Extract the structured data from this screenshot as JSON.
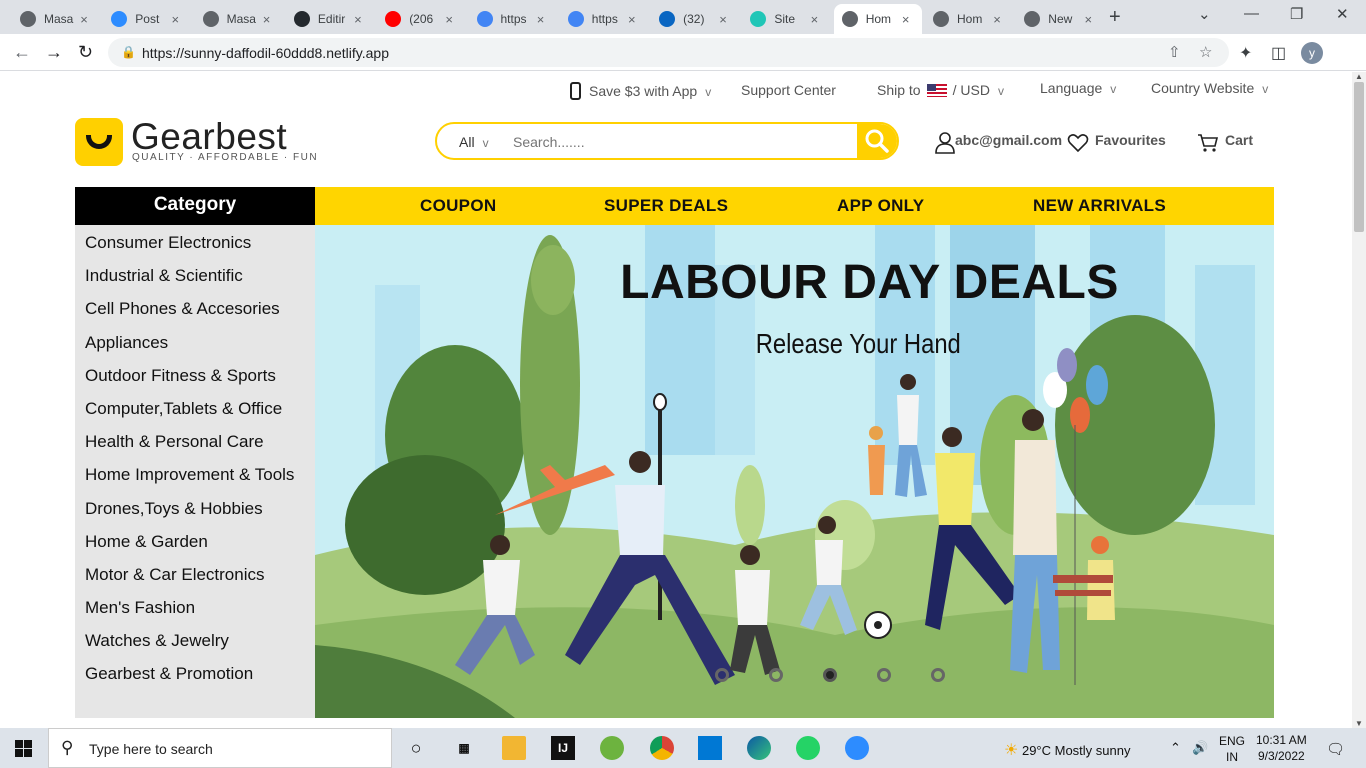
{
  "browser": {
    "tabs": [
      {
        "title": "Masa",
        "icon": "globe-icon",
        "color": "#5f6368"
      },
      {
        "title": "Post",
        "icon": "zoom-icon",
        "color": "#2d8cff"
      },
      {
        "title": "Masa",
        "icon": "globe-icon",
        "color": "#5f6368"
      },
      {
        "title": "Editir",
        "icon": "github-icon",
        "color": "#24292e"
      },
      {
        "title": "(206",
        "icon": "youtube-icon",
        "color": "#ff0000"
      },
      {
        "title": "https",
        "icon": "google-icon",
        "color": "#4285f4"
      },
      {
        "title": "https",
        "icon": "google-icon",
        "color": "#4285f4"
      },
      {
        "title": "(32)",
        "icon": "linkedin-icon",
        "color": "#0a66c2"
      },
      {
        "title": "Site",
        "icon": "netlify-icon",
        "color": "#20c6b7"
      },
      {
        "title": "Hom",
        "icon": "globe-icon",
        "color": "#5f6368",
        "active": true
      },
      {
        "title": "Hom",
        "icon": "globe-icon",
        "color": "#5f6368"
      },
      {
        "title": "New",
        "icon": "chrome-icon",
        "color": "#5f6368"
      }
    ],
    "url": "https://sunny-daffodil-60ddd8.netlify.app",
    "profile_initial": "y"
  },
  "topbar": {
    "app": "Save $3 with App",
    "support": "Support Center",
    "ship": "Ship to",
    "currency": "/ USD",
    "language": "Language",
    "country": "Country Website",
    "caret": "v"
  },
  "header": {
    "logo": "Gearbest",
    "tagline": "QUALITY · AFFORDABLE · FUN",
    "search_scope": "All",
    "search_caret": "v",
    "search_placeholder": "Search.......",
    "account": "abc@gmail.com",
    "favourites": "Favourites",
    "cart": "Cart"
  },
  "category": {
    "title": "Category",
    "items": [
      "Consumer Electronics",
      "Industrial & Scientific",
      "Cell Phones & Accesories",
      "Appliances",
      "Outdoor Fitness & Sports",
      "Computer,Tablets & Office",
      "Health & Personal Care",
      "Home Improvement & Tools",
      "Drones,Toys & Hobbies",
      "Home & Garden",
      "Motor & Car Electronics",
      "Men's Fashion",
      "Watches & Jewelry",
      "Gearbest & Promotion"
    ]
  },
  "nav": {
    "items": [
      "COUPON",
      "SUPER DEALS",
      "APP ONLY",
      "NEW ARRIVALS"
    ]
  },
  "banner": {
    "title": "LABOUR DAY DEALS",
    "subtitle": "Release Your Hand",
    "slides": 5,
    "active_slide": 3
  },
  "taskbar": {
    "search_placeholder": "Type here to search",
    "weather": "29°C  Mostly sunny",
    "lang_top": "ENG",
    "lang_bottom": "IN",
    "time": "10:31 AM",
    "date": "9/3/2022"
  }
}
